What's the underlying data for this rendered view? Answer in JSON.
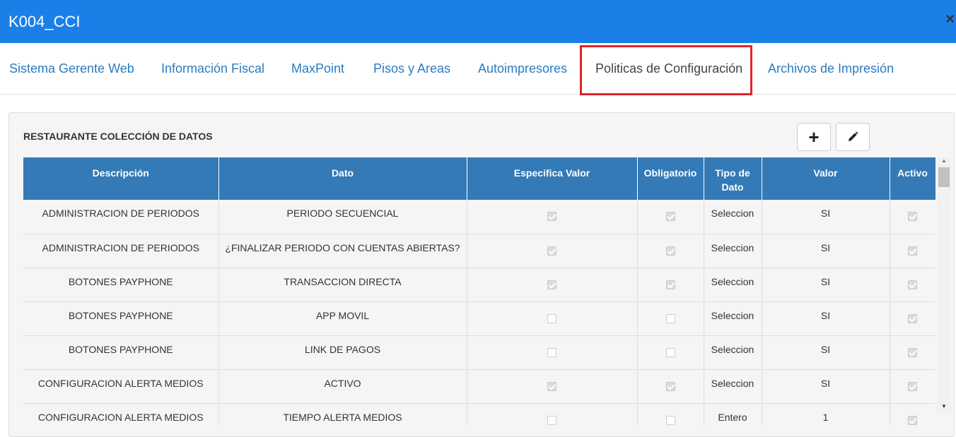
{
  "header": {
    "title": "K004_CCI",
    "close_label": "×"
  },
  "tabs": [
    {
      "label": "Sistema Gerente Web"
    },
    {
      "label": "Información Fiscal"
    },
    {
      "label": "MaxPoint"
    },
    {
      "label": "Pisos y Areas"
    },
    {
      "label": "Autoimpresores"
    },
    {
      "label": "Politicas de Configuración"
    },
    {
      "label": "Archivos de Impresión"
    }
  ],
  "active_tab": "Politicas de Configuración",
  "panel": {
    "title": "RESTAURANTE COLECCIÓN DE DATOS",
    "add_label": "+"
  },
  "table": {
    "headers": [
      "Descripción",
      "Dato",
      "Especifica Valor",
      "Obligatorio",
      "Tipo de Dato",
      "Valor",
      "Activo"
    ],
    "rows": [
      {
        "descripcion": "ADMINISTRACION DE PERIODOS",
        "dato": "PERIODO SECUENCIAL",
        "especifica": true,
        "obligatorio": true,
        "tipo": "Seleccion",
        "valor": "SI",
        "activo": true
      },
      {
        "descripcion": "ADMINISTRACION DE PERIODOS",
        "dato": "¿FINALIZAR PERIODO CON CUENTAS ABIERTAS?",
        "especifica": true,
        "obligatorio": true,
        "tipo": "Seleccion",
        "valor": "SI",
        "activo": true
      },
      {
        "descripcion": "BOTONES PAYPHONE",
        "dato": "TRANSACCION DIRECTA",
        "especifica": true,
        "obligatorio": true,
        "tipo": "Seleccion",
        "valor": "SI",
        "activo": true
      },
      {
        "descripcion": "BOTONES PAYPHONE",
        "dato": "APP MOVIL",
        "especifica": false,
        "obligatorio": false,
        "tipo": "Seleccion",
        "valor": "SI",
        "activo": true
      },
      {
        "descripcion": "BOTONES PAYPHONE",
        "dato": "LINK DE PAGOS",
        "especifica": false,
        "obligatorio": false,
        "tipo": "Seleccion",
        "valor": "SI",
        "activo": true
      },
      {
        "descripcion": "CONFIGURACION ALERTA MEDIOS",
        "dato": "ACTIVO",
        "especifica": true,
        "obligatorio": true,
        "tipo": "Seleccion",
        "valor": "SI",
        "activo": true
      },
      {
        "descripcion": "CONFIGURACION ALERTA MEDIOS",
        "dato": "TIEMPO ALERTA MEDIOS",
        "especifica": false,
        "obligatorio": false,
        "tipo": "Entero",
        "valor": "1",
        "activo": true
      }
    ]
  },
  "colors": {
    "header_bg": "#1a80e8",
    "table_header_bg": "#337ab7",
    "tab_link": "#2b7cc0",
    "highlight": "#e0242c"
  }
}
